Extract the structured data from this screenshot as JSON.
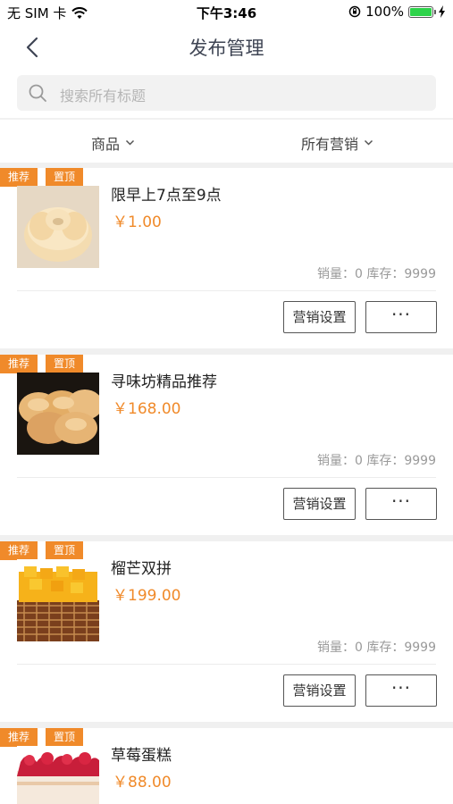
{
  "status_bar": {
    "carrier": "无 SIM 卡",
    "time": "下午3:46",
    "battery": "100%",
    "battery_level": 1.0,
    "icons": [
      "wifi-icon",
      "orientation-lock-icon",
      "battery-icon",
      "charging-icon"
    ]
  },
  "nav": {
    "title": "发布管理",
    "back_icon": "chevron-left-icon"
  },
  "search": {
    "placeholder": "搜索所有标题",
    "icon": "search-icon"
  },
  "filters": {
    "goods_label": "商品",
    "marketing_label": "所有营销",
    "icon": "chevron-down-icon"
  },
  "colors": {
    "accent": "#f08a2a",
    "battery": "#2dd34a"
  },
  "products": [
    {
      "tag_recommend": "推荐",
      "tag_top": "置顶",
      "name": "限早上7点至9点",
      "price": "￥1.00",
      "stats": "销量：0 库存：9999",
      "marketing_button": "营销设置",
      "more_button": "···"
    },
    {
      "tag_recommend": "推荐",
      "tag_top": "置顶",
      "name": "寻味坊精品推荐",
      "price": "￥168.00",
      "stats": "销量：0 库存：9999",
      "marketing_button": "营销设置",
      "more_button": "···"
    },
    {
      "tag_recommend": "推荐",
      "tag_top": "置顶",
      "name": "榴芒双拼",
      "price": "￥199.00",
      "stats": "销量：0 库存：9999",
      "marketing_button": "营销设置",
      "more_button": "···"
    },
    {
      "tag_recommend": "推荐",
      "tag_top": "置顶",
      "name": "草莓蛋糕",
      "price": "￥88.00",
      "stats": "",
      "marketing_button": "",
      "more_button": ""
    }
  ]
}
